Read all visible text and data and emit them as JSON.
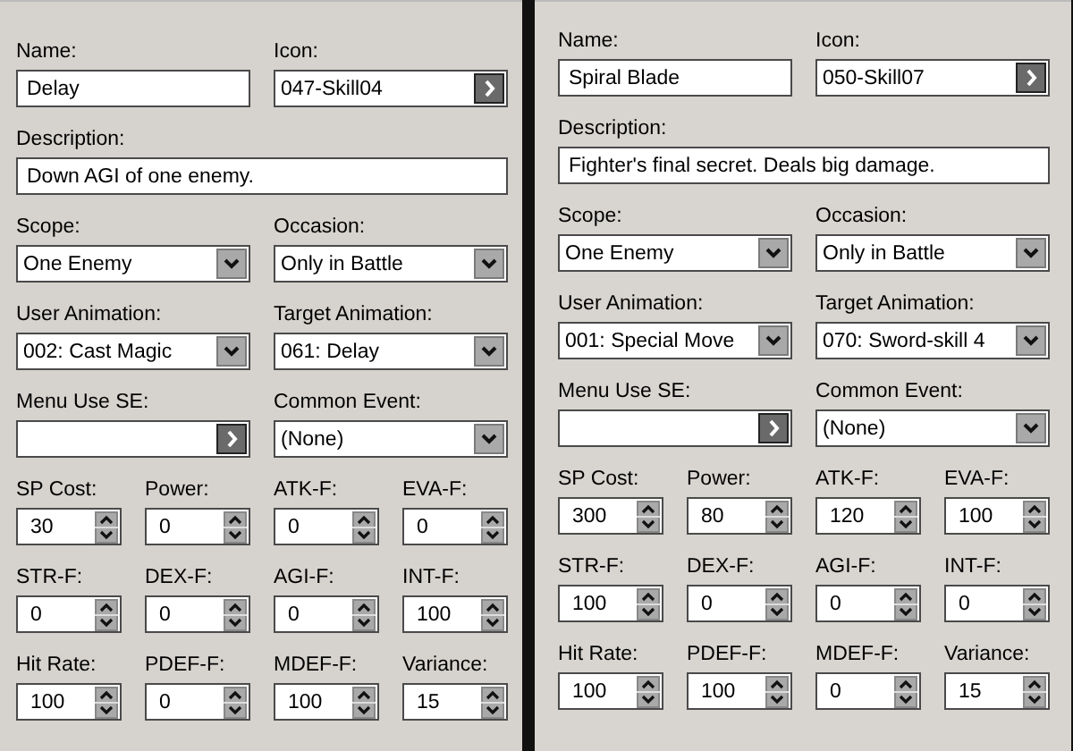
{
  "panels": [
    {
      "fields": [
        {
          "kind": "text",
          "label": "Name:",
          "value": "Delay"
        },
        {
          "kind": "picker",
          "label": "Icon:",
          "value": "047-Skill04"
        },
        {
          "kind": "wide",
          "label": "Description:",
          "value": "Down AGI of one enemy."
        },
        {
          "kind": "dropdown",
          "label": "Scope:",
          "value": "One Enemy"
        },
        {
          "kind": "dropdown",
          "label": "Occasion:",
          "value": "Only in Battle"
        },
        {
          "kind": "dropdown",
          "label": "User Animation:",
          "value": "002: Cast Magic"
        },
        {
          "kind": "dropdown",
          "label": "Target Animation:",
          "value": "061: Delay"
        },
        {
          "kind": "picker",
          "label": "Menu Use SE:"
        },
        {
          "kind": "dropdown",
          "label": "Common Event:",
          "value": "(None)"
        },
        {
          "kind": "spin",
          "label": "SP Cost:",
          "value": "30"
        },
        {
          "kind": "spin",
          "label": "Power:",
          "value": "0"
        },
        {
          "kind": "spin",
          "label": "ATK-F:",
          "value": "0"
        },
        {
          "kind": "spin",
          "label": "EVA-F:",
          "value": "0"
        },
        {
          "kind": "spin",
          "label": "STR-F:",
          "value": "0"
        },
        {
          "kind": "spin",
          "label": "DEX-F:",
          "value": "0"
        },
        {
          "kind": "spin",
          "label": "AGI-F:",
          "value": "0"
        },
        {
          "kind": "spin",
          "label": "INT-F:",
          "value": "100"
        },
        {
          "kind": "spin",
          "label": "Hit Rate:",
          "value": "100"
        },
        {
          "kind": "spin",
          "label": "PDEF-F:",
          "value": "0"
        },
        {
          "kind": "spin",
          "label": "MDEF-F:",
          "value": "100"
        },
        {
          "kind": "spin",
          "label": "Variance:",
          "value": "15"
        }
      ]
    },
    {
      "fields": [
        {
          "kind": "text",
          "label": "Name:",
          "value": "Spiral Blade"
        },
        {
          "kind": "picker",
          "label": "Icon:",
          "value": "050-Skill07"
        },
        {
          "kind": "wide",
          "label": "Description:",
          "value": "Fighter's final secret. Deals big damage."
        },
        {
          "kind": "dropdown",
          "label": "Scope:",
          "value": "One Enemy"
        },
        {
          "kind": "dropdown",
          "label": "Occasion:",
          "value": "Only in Battle"
        },
        {
          "kind": "dropdown",
          "label": "User Animation:",
          "value": "001: Special Move"
        },
        {
          "kind": "dropdown",
          "label": "Target Animation:",
          "value": "070: Sword-skill 4"
        },
        {
          "kind": "picker",
          "label": "Menu Use SE:"
        },
        {
          "kind": "dropdown",
          "label": "Common Event:",
          "value": "(None)"
        },
        {
          "kind": "spin",
          "label": "SP Cost:",
          "value": "300"
        },
        {
          "kind": "spin",
          "label": "Power:",
          "value": "80"
        },
        {
          "kind": "spin",
          "label": "ATK-F:",
          "value": "120"
        },
        {
          "kind": "spin",
          "label": "EVA-F:",
          "value": "100"
        },
        {
          "kind": "spin",
          "label": "STR-F:",
          "value": "100"
        },
        {
          "kind": "spin",
          "label": "DEX-F:",
          "value": "0"
        },
        {
          "kind": "spin",
          "label": "AGI-F:",
          "value": "0"
        },
        {
          "kind": "spin",
          "label": "INT-F:",
          "value": "0"
        },
        {
          "kind": "spin",
          "label": "Hit Rate:",
          "value": "100"
        },
        {
          "kind": "spin",
          "label": "PDEF-F:",
          "value": "100"
        },
        {
          "kind": "spin",
          "label": "MDEF-F:",
          "value": "0"
        },
        {
          "kind": "spin",
          "label": "Variance:",
          "value": "15"
        }
      ]
    }
  ]
}
